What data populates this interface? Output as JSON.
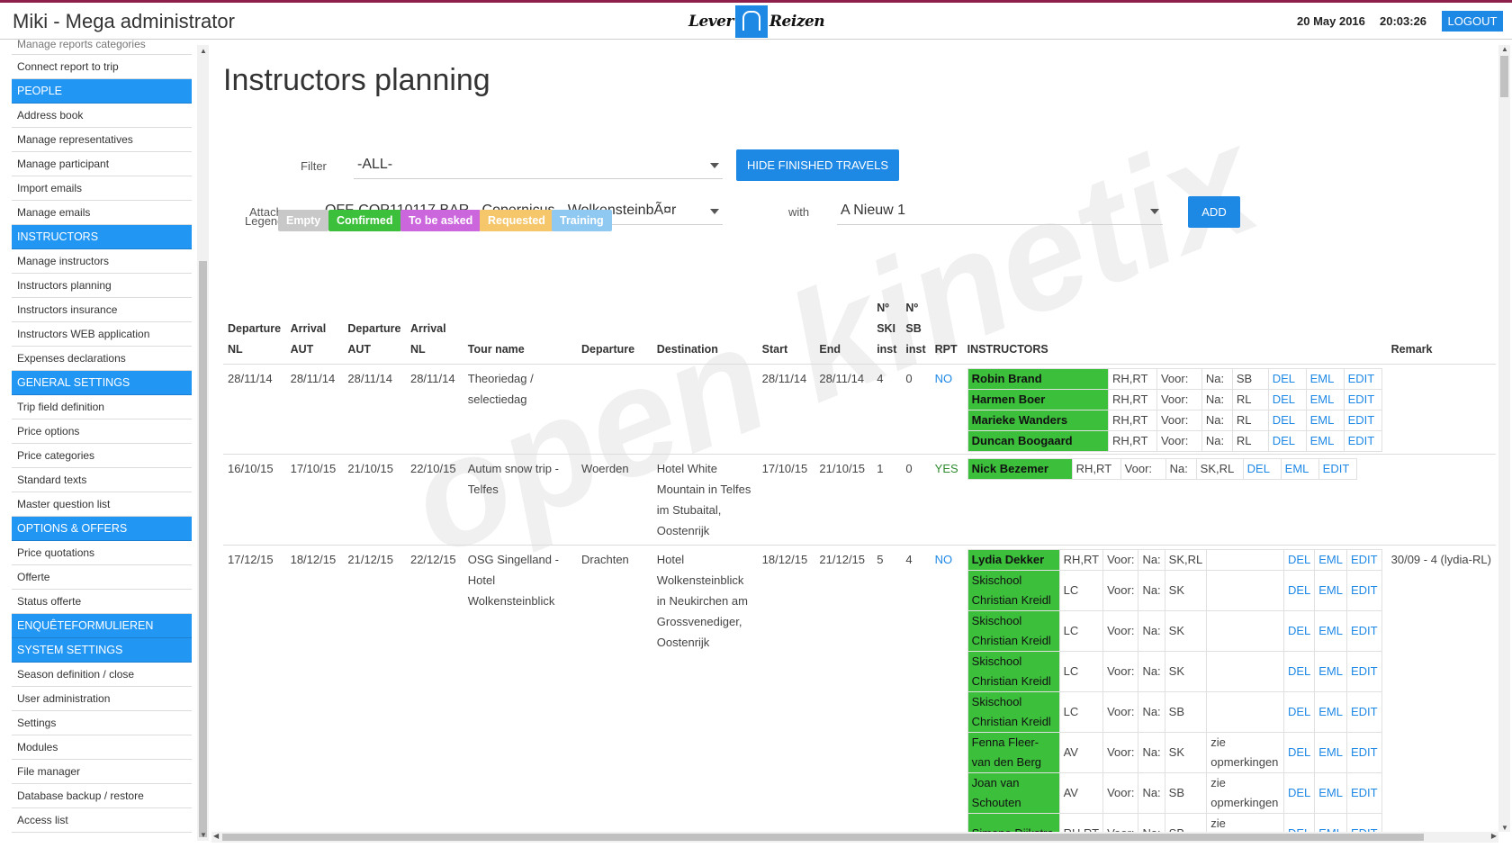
{
  "header": {
    "app_title": "Miki - Mega administrator",
    "logo_left": "Lever",
    "logo_right": "Reizen",
    "date": "20 May 2016",
    "time": "20:03:26",
    "logout_label": "LOGOUT"
  },
  "sidebar": {
    "items": [
      {
        "type": "item",
        "label": "Manage reports categories"
      },
      {
        "type": "item",
        "label": "Connect report to trip"
      },
      {
        "type": "head",
        "label": "PEOPLE"
      },
      {
        "type": "item",
        "label": "Address book"
      },
      {
        "type": "item",
        "label": "Manage representatives"
      },
      {
        "type": "item",
        "label": "Manage participant"
      },
      {
        "type": "item",
        "label": "Import emails"
      },
      {
        "type": "item",
        "label": "Manage emails"
      },
      {
        "type": "head",
        "label": "INSTRUCTORS"
      },
      {
        "type": "item",
        "label": "Manage instructors"
      },
      {
        "type": "item",
        "label": "Instructors planning"
      },
      {
        "type": "item",
        "label": "Instructors insurance"
      },
      {
        "type": "item",
        "label": "Instructors WEB application"
      },
      {
        "type": "item",
        "label": "Expenses declarations"
      },
      {
        "type": "head",
        "label": "GENERAL SETTINGS"
      },
      {
        "type": "item",
        "label": "Trip field definition"
      },
      {
        "type": "item",
        "label": "Price options"
      },
      {
        "type": "item",
        "label": "Price categories"
      },
      {
        "type": "item",
        "label": "Standard texts"
      },
      {
        "type": "item",
        "label": "Master question list"
      },
      {
        "type": "head",
        "label": "OPTIONS & OFFERS"
      },
      {
        "type": "item",
        "label": "Price quotations"
      },
      {
        "type": "item",
        "label": "Offerte"
      },
      {
        "type": "item",
        "label": "Status offerte"
      },
      {
        "type": "head",
        "label": "ENQUÊTEFORMULIEREN"
      },
      {
        "type": "head",
        "label": "SYSTEM SETTINGS"
      },
      {
        "type": "item",
        "label": "Season definition / close"
      },
      {
        "type": "item",
        "label": "User administration"
      },
      {
        "type": "item",
        "label": "Settings"
      },
      {
        "type": "item",
        "label": "Modules"
      },
      {
        "type": "item",
        "label": "File manager"
      },
      {
        "type": "item",
        "label": "Database backup / restore"
      },
      {
        "type": "item",
        "label": "Access list"
      }
    ]
  },
  "main": {
    "title": "Instructors planning",
    "filter_label": "Filter",
    "filter_value": "-ALL-",
    "hide_button": "HIDE FINISHED TRAVELS",
    "attach_label": "Attach",
    "attach_value": "---OFF-COP110117.BAR - Copernicus - WolkensteinbÃ¤r",
    "with_label": "with",
    "with_value": "A Nieuw 1",
    "add_button": "ADD",
    "legend_label": "Legend",
    "legend": [
      {
        "label": "Empty",
        "color": "#c8c8c8"
      },
      {
        "label": "Confirmed",
        "color": "#3cc03c"
      },
      {
        "label": "To be asked",
        "color": "#cc66dd"
      },
      {
        "label": "Requested",
        "color": "#f5c76a"
      },
      {
        "label": "Training",
        "color": "#8fc8f0"
      }
    ],
    "columns": {
      "dep_nl": [
        "Departure",
        "NL"
      ],
      "arr_aut": [
        "Arrival",
        "AUT"
      ],
      "dep_aut": [
        "Departure",
        "AUT"
      ],
      "arr_nl": [
        "Arrival",
        "NL"
      ],
      "tour": "Tour name",
      "departure": "Departure",
      "destination": "Destination",
      "start": "Start",
      "end": "End",
      "ski": [
        "Nº",
        "SKI",
        "inst"
      ],
      "sb": [
        "Nº",
        "SB",
        "inst"
      ],
      "rpt": "RPT",
      "instructors": "INSTRUCTORS",
      "remark": "Remark"
    },
    "trips": [
      {
        "dep_nl": "28/11/14",
        "arr_aut": "28/11/14",
        "dep_aut": "28/11/14",
        "arr_nl": "28/11/14",
        "tour": "Theoriedag / selectiedag",
        "departure": "",
        "destination": "",
        "start": "28/11/14",
        "end": "28/11/14",
        "ski": "4",
        "sb": "0",
        "rpt": "NO",
        "remark": "",
        "instructors": [
          {
            "name": "Robin Brand",
            "code": "RH,RT",
            "voor": "Voor:",
            "na": "Na:",
            "type": "SB",
            "note": ""
          },
          {
            "name": "Harmen Boer",
            "code": "RH,RT",
            "voor": "Voor:",
            "na": "Na:",
            "type": "RL",
            "note": ""
          },
          {
            "name": "Marieke Wanders",
            "code": "RH,RT",
            "voor": "Voor:",
            "na": "Na:",
            "type": "RL",
            "note": ""
          },
          {
            "name": "Duncan Boogaard",
            "code": "RH,RT",
            "voor": "Voor:",
            "na": "Na:",
            "type": "RL",
            "note": ""
          }
        ]
      },
      {
        "dep_nl": "16/10/15",
        "arr_aut": "17/10/15",
        "dep_aut": "21/10/15",
        "arr_nl": "22/10/15",
        "tour": "Autum snow trip - Telfes",
        "departure": "Woerden",
        "destination": "Hotel White Mountain in Telfes im Stubaital, Oostenrijk",
        "start": "17/10/15",
        "end": "21/10/15",
        "ski": "1",
        "sb": "0",
        "rpt": "YES",
        "remark": "",
        "instructors": [
          {
            "name": "Nick Bezemer",
            "code": "RH,RT",
            "voor": "Voor:",
            "na": "Na:",
            "type": "SK,RL",
            "note": ""
          }
        ]
      },
      {
        "dep_nl": "17/12/15",
        "arr_aut": "18/12/15",
        "dep_aut": "21/12/15",
        "arr_nl": "22/12/15",
        "tour": "OSG Singelland - Hotel Wolkensteinblick",
        "departure": "Drachten",
        "destination": "Hotel Wolkensteinblick in Neukirchen am Grossvenediger, Oostenrijk",
        "start": "18/12/15",
        "end": "21/12/15",
        "ski": "5",
        "sb": "4",
        "rpt": "NO",
        "remark": "30/09 - 4 (lydia-RL)",
        "instructors": [
          {
            "name": "Lydia Dekker",
            "code": "RH,RT",
            "voor": "Voor:",
            "na": "Na:",
            "type": "SK,RL",
            "note": ""
          },
          {
            "name": "Skischool Christian Kreidl",
            "code": "LC",
            "voor": "Voor:",
            "na": "Na:",
            "type": "SK",
            "note": ""
          },
          {
            "name": "Skischool Christian Kreidl",
            "code": "LC",
            "voor": "Voor:",
            "na": "Na:",
            "type": "SK",
            "note": ""
          },
          {
            "name": "Skischool Christian Kreidl",
            "code": "LC",
            "voor": "Voor:",
            "na": "Na:",
            "type": "SK",
            "note": ""
          },
          {
            "name": "Skischool Christian Kreidl",
            "code": "LC",
            "voor": "Voor:",
            "na": "Na:",
            "type": "SB",
            "note": ""
          },
          {
            "name": "Fenna Fleer- van den Berg",
            "code": "AV",
            "voor": "Voor:",
            "na": "Na:",
            "type": "SK",
            "note": "zie opmerkingen"
          },
          {
            "name": "Joan van Schouten",
            "code": "AV",
            "voor": "Voor:",
            "na": "Na:",
            "type": "SB",
            "note": "zie opmerkingen"
          },
          {
            "name": "Simone Dijkstra",
            "code": "RH,RT",
            "voor": "Voor:",
            "na": "Na:",
            "type": "SB",
            "note": "zie opmerkingen"
          }
        ]
      }
    ],
    "actions": {
      "del": "DEL",
      "eml": "EML",
      "edit": "EDIT"
    },
    "watermark": "open kinetix"
  }
}
